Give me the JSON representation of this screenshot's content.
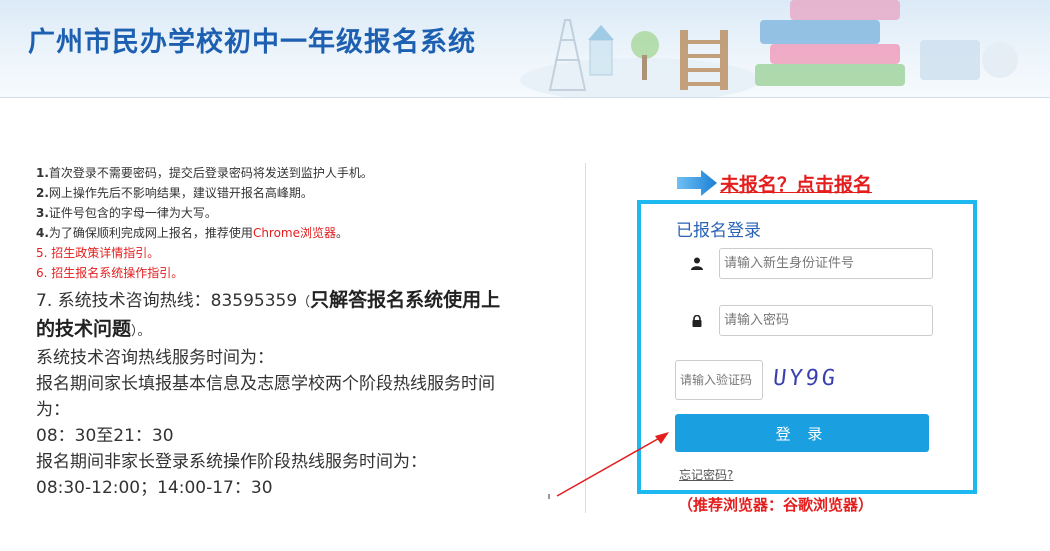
{
  "header": {
    "title": "广州市民办学校初中一年级报名系统"
  },
  "info": {
    "lines": [
      {
        "num": "1.",
        "text": "首次登录不需要密码，提交后登录密码将发送到监护人手机。"
      },
      {
        "num": "2.",
        "text": "网上操作先后不影响结果，建议错开报名高峰期。"
      },
      {
        "num": "3.",
        "text": "证件号包含的字母一律为大写。"
      },
      {
        "num": "4.",
        "text": "为了确保顺利完成网上报名，推荐使用",
        "highlight": "Chrome浏览器",
        "end": "。"
      }
    ],
    "policy_link": "5. 招生政策详情指引。",
    "guide_link": "6. 招生报名系统操作指引。",
    "hotline_prefix": "7. 系统技术咨询热线：83595359",
    "hotline_open": "（",
    "hotline_strong": "只解答报名系统使用上的技术问题",
    "hotline_close": "）。",
    "service_title": "系统技术咨询热线服务时间为：",
    "period1_title": "报名期间家长填报基本信息及志愿学校两个阶段热线服务时间为：",
    "period1_time": "08：30至21：30",
    "period2_title": "报名期间非家长登录系统操作阶段热线服务时间为：",
    "period2_time": "08:30-12:00；14:00-17：30"
  },
  "register_link": "未报名？点击报名",
  "login": {
    "title": "已报名登录",
    "id_placeholder": "请输入新生身份证件号",
    "password_placeholder": "请输入密码",
    "captcha_placeholder": "请输入验证码",
    "captcha_text": "UY9G",
    "login_button": "登 录",
    "forgot_link": "忘记密码?"
  },
  "browser_tip": "（推荐浏览器：谷歌浏览器）",
  "colors": {
    "brand_blue": "#1d5fb0",
    "accent_cyan": "#1db8ef",
    "button_blue": "#1a9fe0",
    "alert_red": "#e41d1d"
  }
}
